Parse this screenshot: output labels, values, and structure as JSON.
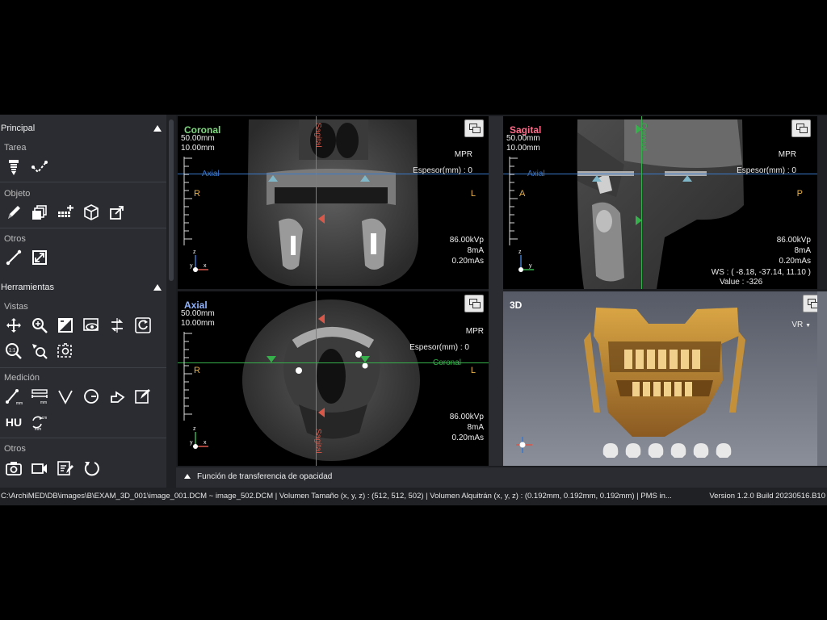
{
  "sidebar": {
    "principal": "Principal",
    "tarea": "Tarea",
    "objeto": "Objeto",
    "otros": "Otros",
    "herramientas": "Herramientas",
    "vistas": "Vistas",
    "medicion": "Medición",
    "otros2": "Otros",
    "hu_label": "HU"
  },
  "viewports": {
    "coronal": {
      "title": "Coronal",
      "title_color": "#7fd97f",
      "dim1": "50.00mm",
      "dim2": "10.00mm",
      "mode": "MPR",
      "thickness": "Espesor(mm) :  0",
      "left": "R",
      "right": "L",
      "kvp": "86.00kVp",
      "ma": "8mA",
      "mas": "0.20mAs",
      "h_line_label": "Axial",
      "v_line_label": "Sagital"
    },
    "sagital": {
      "title": "Sagital",
      "title_color": "#ff6b8a",
      "dim1": "50.00mm",
      "dim2": "10.00mm",
      "mode": "MPR",
      "thickness": "Espesor(mm) :  0",
      "left": "A",
      "right": "P",
      "kvp": "86.00kVp",
      "ma": "8mA",
      "mas": "0.20mAs",
      "ws": "WS : ( -8.18, -37.14, 11.10 )",
      "value": "Value : -326",
      "h_line_label": "Axial",
      "v_line_label": "Coronal"
    },
    "axial": {
      "title": "Axial",
      "title_color": "#8fb4ff",
      "dim1": "50.00mm",
      "dim2": "10.00mm",
      "mode": "MPR",
      "thickness": "Espesor(mm) :  0",
      "left": "R",
      "right": "L",
      "kvp": "86.00kVp",
      "ma": "8mA",
      "mas": "0.20mAs",
      "h_line_label": "Coronal",
      "v_line_label": "Sagital"
    },
    "three_d": {
      "title": "3D",
      "render_mode": "VR"
    }
  },
  "otf": {
    "label": "Función de transferencia de opacidad"
  },
  "status": {
    "path": "C:\\ArchiMED\\DB\\images\\B\\EXAM_3D_001\\image_001.DCM ~ image_502.DCM  |  Volumen Tamaño (x, y, z) : (512, 512, 502)  |  Volumen Alquitrán (x, y, z) : (0.192mm, 0.192mm, 0.192mm)  |  PMS in...",
    "version": "Version 1.2.0 Build 20230516.B10"
  },
  "icons": [
    "implant-icon",
    "check-curve-icon",
    "pencil-icon",
    "layers-icon",
    "grid-plus-icon",
    "cube-icon",
    "export-icon",
    "line-icon",
    "resize-icon",
    "pan-icon",
    "zoom-icon",
    "window-level-icon",
    "eye-view-icon",
    "flip-icon",
    "rotate-icon",
    "zoom-1to1-icon",
    "zoom-region-icon",
    "capture-region-icon",
    "ruler-icon",
    "distance-icon",
    "angle-icon",
    "cobb-icon",
    "arrow-icon",
    "edit-note-icon",
    "cm-area-icon",
    "camera-icon",
    "video-icon",
    "report-icon",
    "reset-icon"
  ],
  "colors": {
    "app_bg": "#1b1d21",
    "sidebar_bg": "#2a2c31",
    "crosshair_blue": "#3a78c9",
    "crosshair_green": "#35b04a",
    "crosshair_red": "#d8594a"
  }
}
